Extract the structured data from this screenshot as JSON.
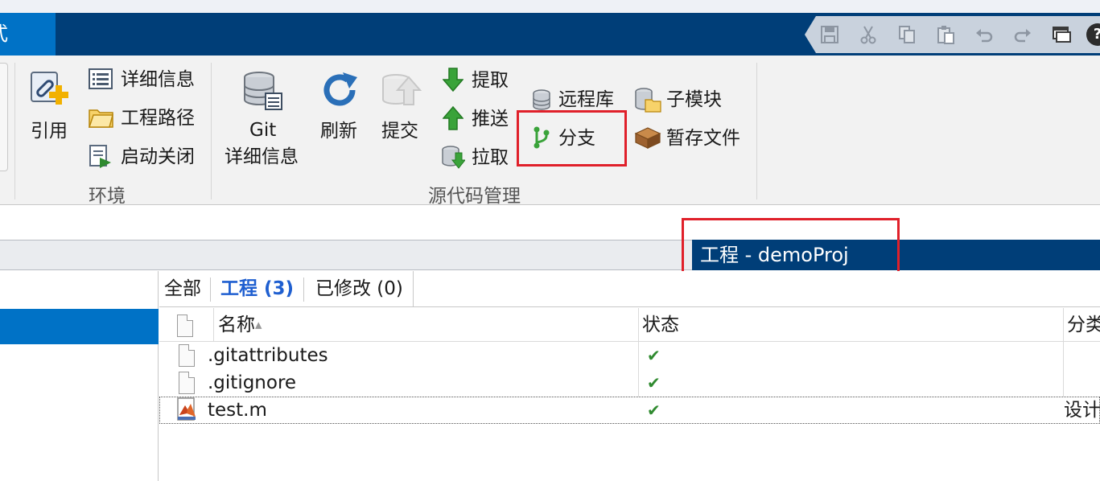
{
  "tabbar": {
    "active_tab_label": "式"
  },
  "quick_access": {
    "icons": [
      "save-icon",
      "cut-icon",
      "copy-icon",
      "paste-icon",
      "undo-icon",
      "redo-icon",
      "window-icon",
      "help-icon"
    ],
    "help_label": "?"
  },
  "ribbon": {
    "reference_label": "引用",
    "details_label": "详细信息",
    "project_path_label": "工程路径",
    "startup_shutdown_label": "启动关闭",
    "environment_group": "环境",
    "git_details_label_line1": "Git",
    "git_details_label_line2": "详细信息",
    "refresh_label": "刷新",
    "commit_label": "提交",
    "fetch_label": "提取",
    "push_label": "推送",
    "pull_label": "拉取",
    "remote_label": "远程库",
    "branch_label": "分支",
    "submodule_label": "子模块",
    "stash_label": "暂存文件",
    "source_control_group": "源代码管理"
  },
  "project": {
    "title": "工程 - demoProj"
  },
  "subtabs": {
    "all": "全部",
    "project": "工程 (3)",
    "modified": "已修改 (0)"
  },
  "table": {
    "headers": {
      "name": "名称",
      "status": "状态",
      "classification": "分类"
    },
    "rows": [
      {
        "name": ".gitattributes",
        "status": "✔",
        "classification": ""
      },
      {
        "name": ".gitignore",
        "status": "✔",
        "classification": ""
      },
      {
        "name": "test.m",
        "status": "✔",
        "classification": "设计"
      }
    ]
  },
  "colors": {
    "tabbar": "#003e78",
    "active_tab": "#0072c6",
    "highlight_box": "#e0202a",
    "check": "#2f8a2f",
    "active_subtab": "#1f5fd0"
  }
}
